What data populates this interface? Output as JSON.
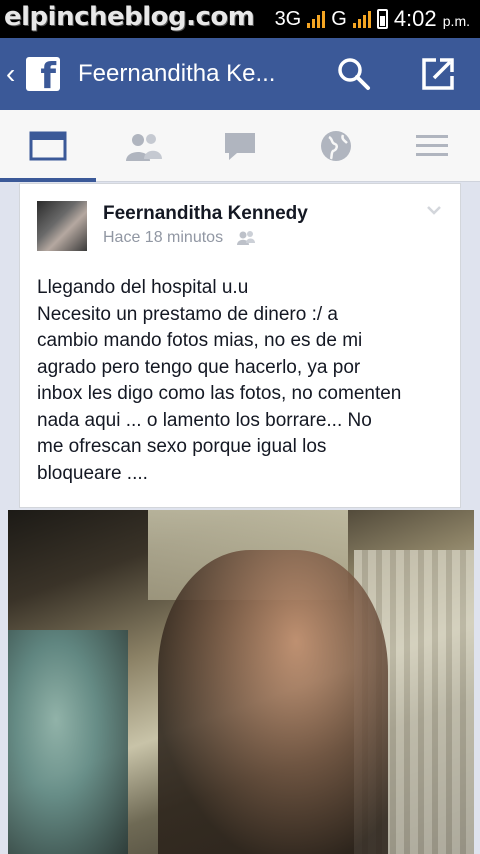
{
  "status_bar": {
    "watermark": "elpincheblog.com",
    "network": "3G",
    "carrier_g": "G",
    "time": "4:02",
    "ampm": "p.m."
  },
  "header": {
    "title": "Feernanditha Ke...",
    "icons": [
      "back-chevron-icon",
      "facebook-logo-icon",
      "search-icon",
      "share-icon"
    ],
    "color": "#3b5998"
  },
  "tabs": [
    {
      "name": "news-feed",
      "icon": "news-feed-icon",
      "active": true
    },
    {
      "name": "friend-requests",
      "icon": "friends-icon",
      "active": false
    },
    {
      "name": "messages",
      "icon": "chat-icon",
      "active": false
    },
    {
      "name": "notifications",
      "icon": "globe-icon",
      "active": false
    },
    {
      "name": "more",
      "icon": "menu-icon",
      "active": false
    }
  ],
  "post": {
    "author": "Feernanditha Kennedy",
    "time": "Hace 18 minutos",
    "privacy_icon": "friends-audience-icon",
    "lines": [
      "Llegando del hospital u.u",
      "Necesito un prestamo de dinero :/ a",
      "cambio mando fotos mias, no es de mi",
      "agrado pero tengo que hacerlo, ya por",
      "inbox les digo como las fotos, no comenten",
      "nada aqui ... o lamento los borrare...  No",
      "me ofrescan sexo porque igual los",
      "bloqueare ...."
    ]
  }
}
